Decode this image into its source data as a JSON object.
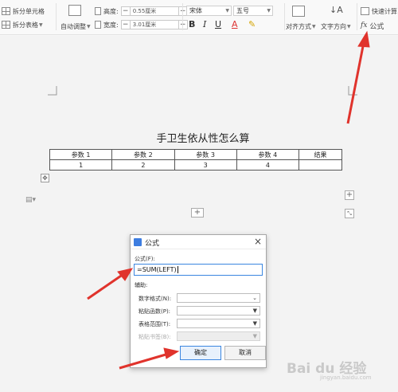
{
  "ribbon": {
    "split_cells": "拆分单元格",
    "split_table": "拆分表格",
    "auto_adjust": "自动调整",
    "height_label": "高度:",
    "height_value": "0.55厘米",
    "width_label": "宽度:",
    "width_value": "3.01厘米",
    "font_name": "宋体",
    "font_size": "五号",
    "align": "对齐方式",
    "text_dir": "文字方向",
    "quick_calc": "快速计算",
    "formula": "公式",
    "bold": "B",
    "italic": "I",
    "underline": "U",
    "fontcolor": "A",
    "minus": "−",
    "plus": "+"
  },
  "document": {
    "title": "手卫生依从性怎么算",
    "table": {
      "headers": [
        "参数 1",
        "参数 2",
        "参数 3",
        "参数 4",
        "结果"
      ],
      "rows": [
        [
          "1",
          "2",
          "3",
          "4",
          ""
        ]
      ]
    },
    "add_symbol": "+"
  },
  "dialog": {
    "title": "公式",
    "close": "×",
    "formula_label": "公式(F):",
    "formula_value": "=SUM(LEFT)",
    "aux_label": "辅助:",
    "number_format_label": "数字格式(N):",
    "paste_function_label": "粘贴函数(P):",
    "table_range_label": "表格范围(T):",
    "paste_bookmark_label": "粘贴书签(B):",
    "ok": "确定",
    "cancel": "取消"
  },
  "watermark": {
    "brand": "Bai du 经验",
    "url": "jingyan.baidu.com"
  },
  "colors": {
    "arrow": "#e0332c",
    "accent": "#3b86e0"
  }
}
